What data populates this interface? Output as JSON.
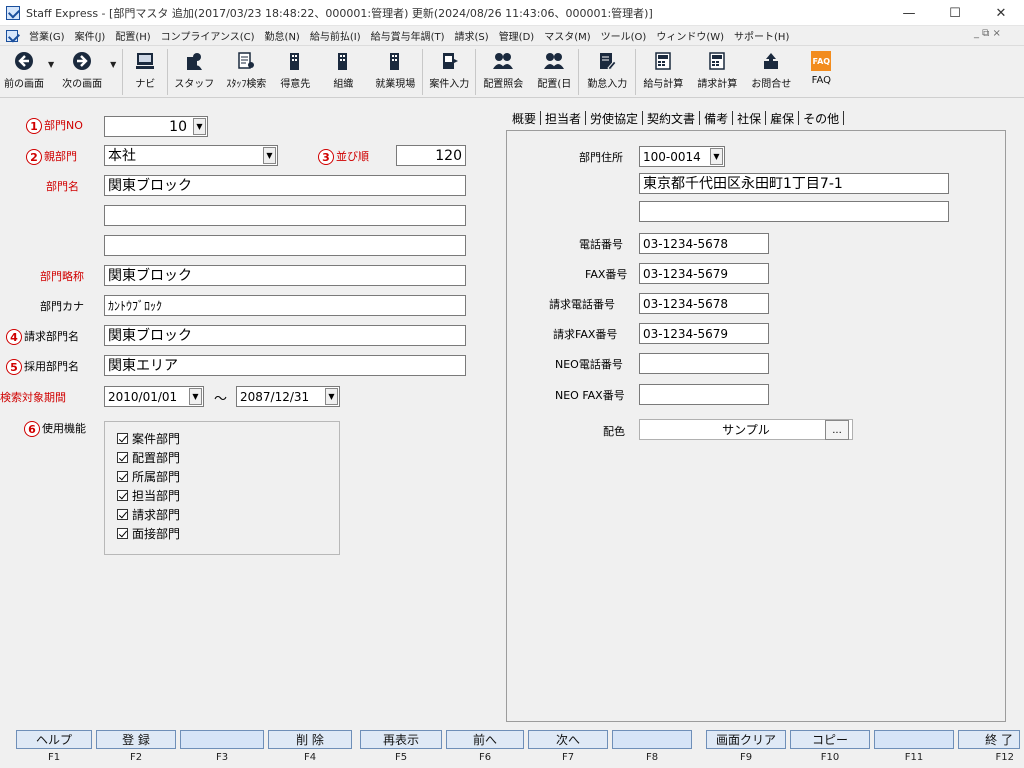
{
  "window": {
    "title": "Staff Express - [部門マスタ 追加(2017/03/23 18:48:22、000001:管理者) 更新(2024/08/26 11:43:06、000001:管理者)]",
    "controls": [
      "—",
      "☐",
      "✕"
    ]
  },
  "menubar": {
    "items": [
      "営業(G)",
      "案件(J)",
      "配置(H)",
      "コンプライアンス(C)",
      "勤怠(N)",
      "給与前払(I)",
      "給与賞与年調(T)",
      "請求(S)",
      "管理(D)",
      "マスタ(M)",
      "ツール(O)",
      "ウィンドウ(W)",
      "サポート(H)"
    ],
    "mdi_controls": "_ ⧉ ×"
  },
  "toolbar": {
    "back": "前の画面",
    "forward": "次の画面",
    "navi": "ナビ",
    "staff": "スタッフ",
    "staff_search": "ｽﾀｯﾌ検索",
    "client": "得意先",
    "org": "組織",
    "worksite": "就業現場",
    "case_input": "案件入力",
    "placement_inquiry": "配置照会",
    "placement_day": "配置(日",
    "attendance_input": "勤怠入力",
    "payroll_calc": "給与計算",
    "billing_calc": "請求計算",
    "inquiry": "お問合せ",
    "faq": "FAQ",
    "faq_icon_text": "FAQ"
  },
  "form": {
    "dept_no_label": "部門NO",
    "dept_no_value": "10",
    "parent_dept_label": "親部門",
    "parent_dept_value": "本社",
    "sort_order_label": "並び順",
    "sort_order_value": "120",
    "dept_name_label": "部門名",
    "dept_name_1": "関東ブロック",
    "dept_name_2": "",
    "dept_name_3": "",
    "dept_short_label": "部門略称",
    "dept_short_value": "関東ブロック",
    "dept_kana_label": "部門カナ",
    "dept_kana_value": "ｶﾝﾄｳﾌﾞﾛｯｸ",
    "billing_dept_label": "請求部門名",
    "billing_dept_value": "関東ブロック",
    "recruit_dept_label": "採用部門名",
    "recruit_dept_value": "関東エリア",
    "search_period_label": "検索対象期間",
    "period_from": "2010/01/01",
    "period_sep": "～",
    "period_to": "2087/12/31",
    "functions_label": "使用機能",
    "functions": [
      "案件部門",
      "配置部門",
      "所属部門",
      "担当部門",
      "請求部門",
      "面接部門"
    ],
    "markers": [
      "1",
      "2",
      "3",
      "4",
      "5",
      "6"
    ]
  },
  "tabs": [
    "概要",
    "担当者",
    "労使協定",
    "契約文書",
    "備考",
    "社保",
    "雇保",
    "その他"
  ],
  "overview": {
    "address_label": "部門住所",
    "postal_code": "100-0014",
    "address_1": "東京都千代田区永田町1丁目7-1",
    "address_2": "",
    "phone_label": "電話番号",
    "phone_value": "03-1234-5678",
    "fax_label": "FAX番号",
    "fax_value": "03-1234-5679",
    "billing_phone_label": "請求電話番号",
    "billing_phone_value": "03-1234-5678",
    "billing_fax_label": "請求FAX番号",
    "billing_fax_value": "03-1234-5679",
    "neo_phone_label": "NEO電話番号",
    "neo_phone_value": "",
    "neo_fax_label": "NEO FAX番号",
    "neo_fax_value": "",
    "color_label": "配色",
    "color_sample": "サンプル",
    "browse_label": "..."
  },
  "fkeys": [
    {
      "label": "ヘルプ",
      "key": "F1"
    },
    {
      "label": "登 録",
      "key": "F2"
    },
    {
      "label": "",
      "key": "F3"
    },
    {
      "label": "削 除",
      "key": "F4"
    },
    {
      "label": "再表示",
      "key": "F5"
    },
    {
      "label": "前へ",
      "key": "F6"
    },
    {
      "label": "次へ",
      "key": "F7"
    },
    {
      "label": "",
      "key": "F8"
    },
    {
      "label": "画面クリア",
      "key": "F9"
    },
    {
      "label": "コピー",
      "key": "F10"
    },
    {
      "label": "",
      "key": "F11"
    },
    {
      "label": "終 了",
      "key": "F12"
    }
  ]
}
